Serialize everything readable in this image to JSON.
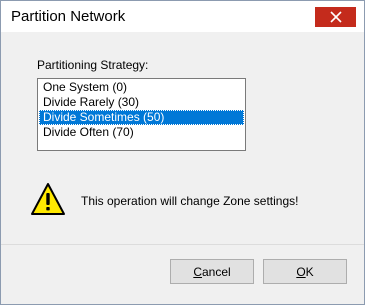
{
  "window": {
    "title": "Partition Network"
  },
  "strategy": {
    "label": "Partitioning Strategy:",
    "items": [
      {
        "label": "One System (0)",
        "selected": false
      },
      {
        "label": "Divide Rarely (30)",
        "selected": false
      },
      {
        "label": "Divide Sometimes (50)",
        "selected": true
      },
      {
        "label": "Divide Often (70)",
        "selected": false
      }
    ]
  },
  "warning": {
    "icon": "warning-icon",
    "message": "This operation will change Zone settings!"
  },
  "buttons": {
    "cancel_label": "Cancel",
    "ok_label": "OK"
  },
  "colors": {
    "selection": "#0078d7",
    "close": "#c42b1c",
    "warning_fill": "#ffe800"
  }
}
